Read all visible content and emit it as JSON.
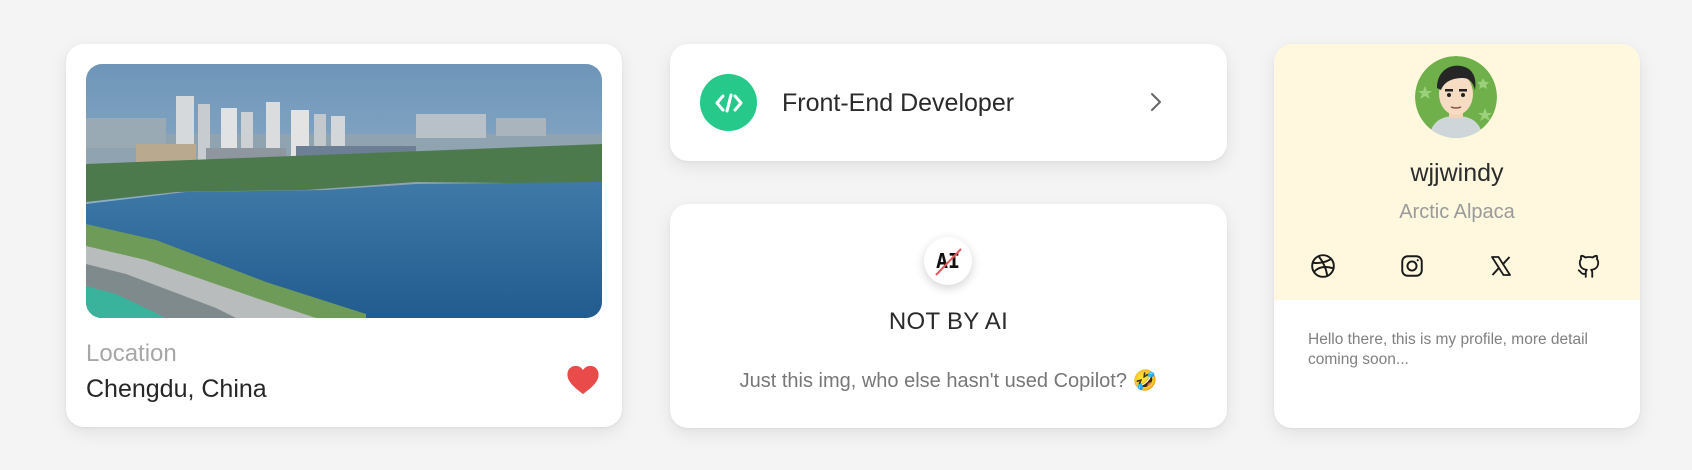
{
  "location_card": {
    "label": "Location",
    "value": "Chengdu, China",
    "photo_icon": "city-lake-photo",
    "heart_icon": "heart-icon",
    "heart_color": "#e94b4b"
  },
  "developer_card": {
    "title": "Front-End Developer",
    "icon": "code-icon",
    "icon_color": "#26c98a",
    "chevron_icon": "chevron-right-icon"
  },
  "ai_card": {
    "badge_text": "AI",
    "title": "NOT BY AI",
    "subtitle": "Just this img, who else hasn't used Copilot? 🤣"
  },
  "profile_card": {
    "username": "wjjwindy",
    "handle": "Arctic Alpaca",
    "background_color": "#fff8df",
    "social_icons": [
      "dribbble-icon",
      "instagram-icon",
      "x-icon",
      "github-icon"
    ],
    "bio": "Hello there, this is my profile, more detail coming soon..."
  }
}
